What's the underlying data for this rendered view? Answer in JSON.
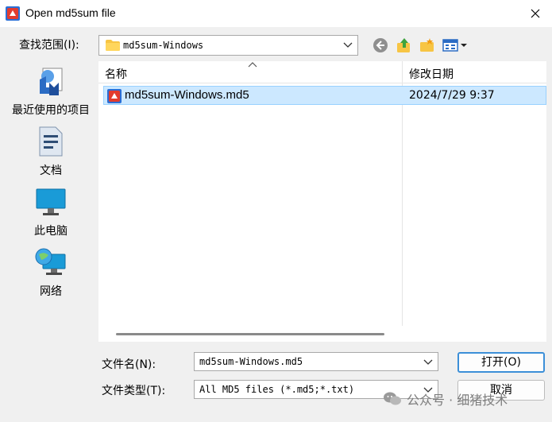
{
  "window": {
    "title": "Open md5sum file"
  },
  "lookin": {
    "label": "查找范围(I):",
    "value": "md5sum-Windows"
  },
  "places": [
    {
      "label": "最近使用的项目",
      "icon": "recent-places-icon"
    },
    {
      "label": "文档",
      "icon": "documents-icon"
    },
    {
      "label": "此电脑",
      "icon": "this-pc-icon"
    },
    {
      "label": "网络",
      "icon": "network-icon"
    }
  ],
  "columns": {
    "name": "名称",
    "date": "修改日期"
  },
  "files": [
    {
      "name": "md5sum-Windows.md5",
      "date": "2024/7/29 9:37",
      "selected": true
    }
  ],
  "filename": {
    "label": "文件名(N):",
    "value": "md5sum-Windows.md5"
  },
  "filetype": {
    "label": "文件类型(T):",
    "value": "All MD5 files (*.md5;*.txt)"
  },
  "buttons": {
    "open": "打开(O)",
    "cancel": "取消"
  },
  "watermark": {
    "text": "公众号 · 细猪技术"
  },
  "colors": {
    "selection": "#cce8ff",
    "accent": "#3c8fd8"
  }
}
